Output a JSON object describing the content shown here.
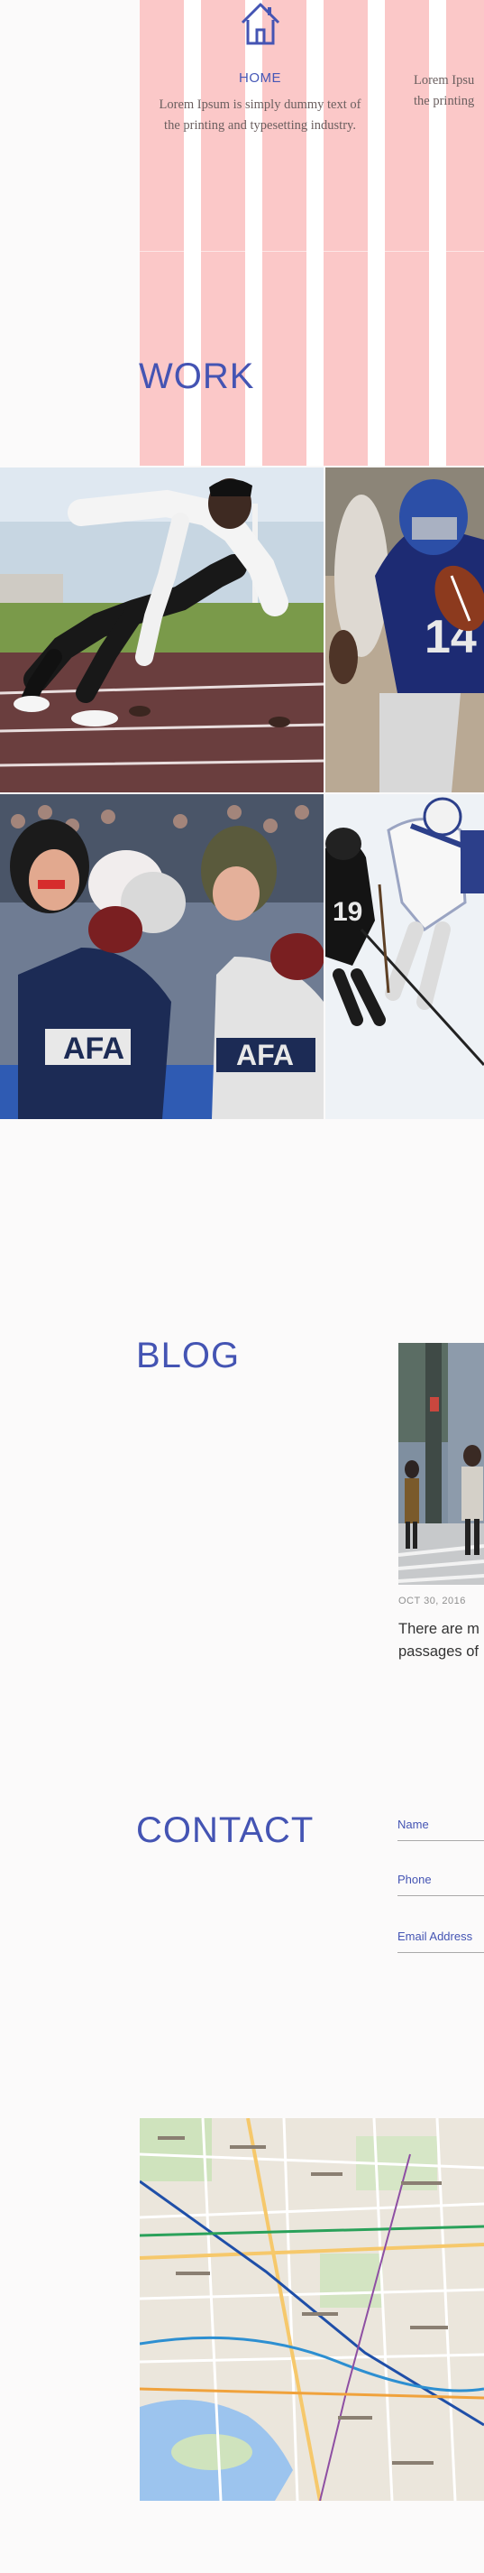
{
  "services": [
    {
      "title": "HOME",
      "description_line1": "Lorem Ipsum is simply dummy text of",
      "description_line2": "the printing and typesetting industry.",
      "icon": "home-icon"
    },
    {
      "title": "",
      "description_line1": "Lorem Ipsu",
      "description_line2": "the printing",
      "icon": ""
    }
  ],
  "work": {
    "title": "WORK",
    "photos": [
      "sprinter-photo",
      "football-player-photo",
      "boxers-photo",
      "hockey-players-photo"
    ]
  },
  "blog": {
    "title": "BLOG",
    "post": {
      "date": "OCT 30, 2016",
      "text_line1": "There are m",
      "text_line2": "passages of"
    }
  },
  "contact": {
    "title": "CONTACT",
    "fields": [
      {
        "label": "Name"
      },
      {
        "label": "Phone"
      },
      {
        "label": "Email Address"
      }
    ]
  },
  "map": {
    "label": "location-map"
  },
  "colors": {
    "accent": "#4454b3",
    "stripe": "#fbc8c8",
    "background": "#fbfafa"
  }
}
